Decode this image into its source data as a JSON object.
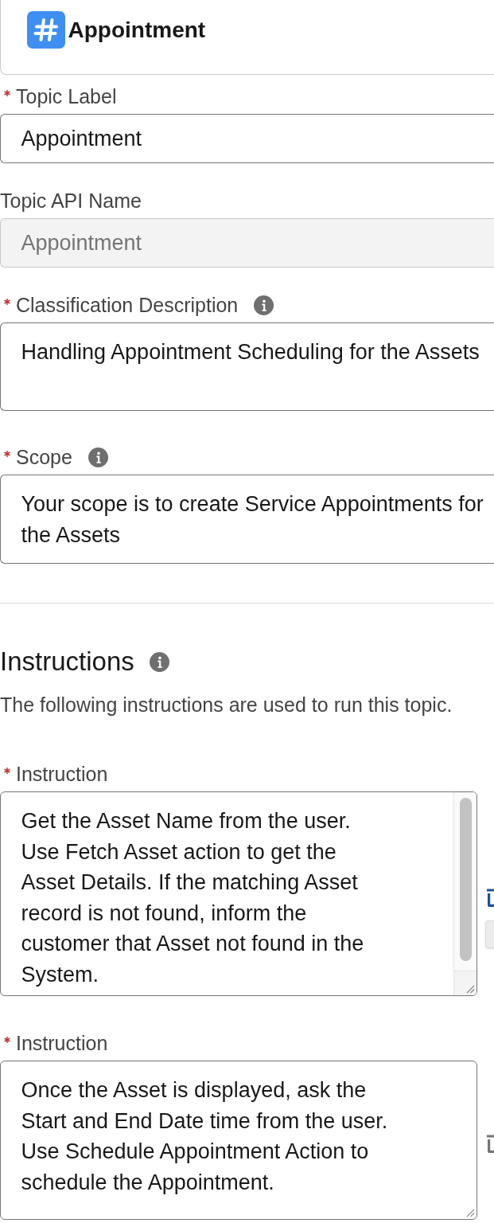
{
  "header": {
    "title": "Appointment"
  },
  "fields": [
    {
      "kind": "input",
      "label": "Topic Label",
      "required": true,
      "info": false,
      "disabled": false,
      "value": "Appointment"
    },
    {
      "kind": "input",
      "label": "Topic API Name",
      "required": false,
      "info": false,
      "disabled": true,
      "value": "Appointment"
    },
    {
      "kind": "textarea",
      "label": "Classification Description",
      "required": true,
      "info": true,
      "disabled": false,
      "value": "Handling Appointment Scheduling for the Assets"
    },
    {
      "kind": "textarea",
      "label": "Scope",
      "required": true,
      "info": true,
      "disabled": false,
      "value": "Your scope is to create Service Appointments for the Assets"
    }
  ],
  "instructions": {
    "heading": "Instructions",
    "info": true,
    "description": "The following instructions are used to run this topic.",
    "items": [
      {
        "label": "Instruction",
        "required": true,
        "value": "Get the Asset Name from the user. Use Fetch Asset action to get the Asset Details. If the matching Asset record is not found, inform the customer that Asset not found in the System.",
        "scrollbar": true,
        "delete_highlighted": true
      },
      {
        "label": "Instruction",
        "required": true,
        "value": "Once the Asset is displayed, ask the Start and End Date time from the user. Use Schedule Appointment Action to schedule the Appointment.",
        "scrollbar": false,
        "delete_highlighted": false
      }
    ]
  }
}
